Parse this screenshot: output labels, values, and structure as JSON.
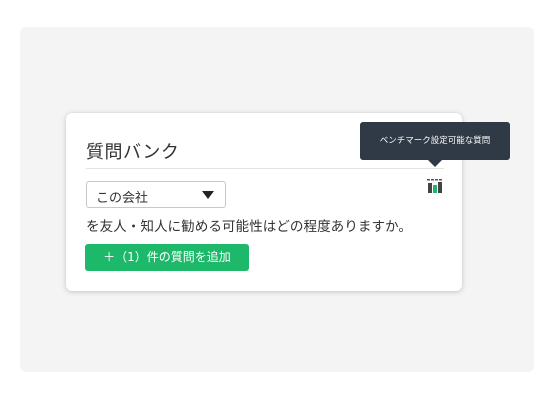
{
  "card": {
    "title": "質問バンク",
    "benchmark_icon": "benchmark-icon",
    "select": {
      "value": "この会社",
      "icon": "caret-down-icon"
    },
    "question": "を友人・知人に勧める可能性はどの程度ありますか。",
    "add_button_label": "＋（1）件の質問を追加"
  },
  "tooltip": {
    "text": "ベンチマーク設定可能な質問"
  },
  "colors": {
    "page_background": "#f4f4f4",
    "accent_green": "#1db86a",
    "tooltip_background": "#2f3a46",
    "text": "#333333"
  }
}
